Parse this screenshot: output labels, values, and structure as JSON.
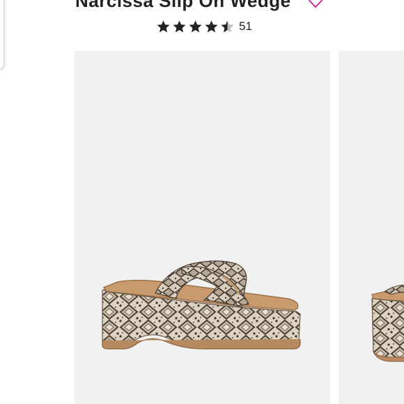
{
  "product": {
    "title": "Narcissa Slip On Wedge",
    "rating": 4.5,
    "rating_max": 5,
    "review_count": "51"
  },
  "colors": {
    "heart_accent": "#c2208f",
    "card_background": "#f1f1f1",
    "star_fill": "#222222"
  },
  "icons": {
    "favorite": "heart-outline-icon",
    "rating": "star-icon"
  }
}
